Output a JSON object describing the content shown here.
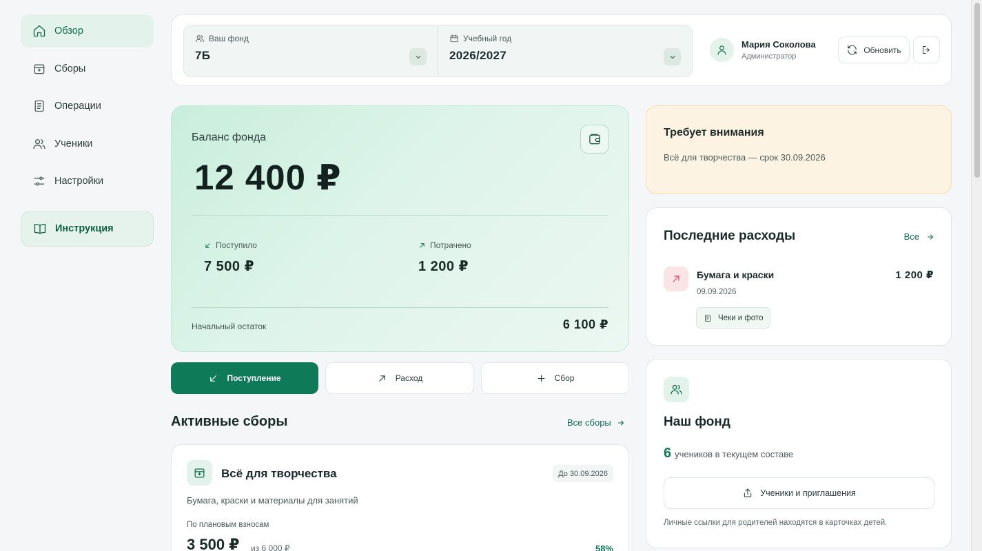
{
  "sidebar": {
    "items": [
      {
        "label": "Обзор",
        "icon": "home-icon",
        "active": true
      },
      {
        "label": "Сборы",
        "icon": "piggy-bank-icon"
      },
      {
        "label": "Операции",
        "icon": "document-icon"
      },
      {
        "label": "Ученики",
        "icon": "users-icon"
      },
      {
        "label": "Настройки",
        "icon": "sliders-icon"
      }
    ],
    "guide": {
      "label": "Инструкция",
      "icon": "book-icon"
    }
  },
  "topbar": {
    "fund_label": "Ваш фонд",
    "fund_value": "7Б",
    "year_label": "Учебный год",
    "year_value": "2026/2027",
    "user_name": "Мария Соколова",
    "user_role": "Администратор",
    "refresh_label": "Обновить"
  },
  "balance": {
    "title": "Баланс фонда",
    "amount": "12 400 ₽",
    "income_label": "Поступило",
    "income_value": "7 500 ₽",
    "spent_label": "Потрачено",
    "spent_value": "1 200 ₽",
    "start_label": "Начальный остаток",
    "start_value": "6 100 ₽"
  },
  "actions": {
    "income": "Поступление",
    "expense": "Расход",
    "collection": "Сбор"
  },
  "collections": {
    "title": "Активные сборы",
    "link": "Все сборы",
    "item": {
      "title": "Всё для творчества",
      "date": "До 30.09.2026",
      "description": "Бумага, краски и материалы для занятий",
      "plan_label": "По плановым взносам",
      "amount": "3 500 ₽",
      "of": "из 6 000 ₽",
      "percent": "58%"
    }
  },
  "attention": {
    "title": "Требует внимания",
    "text": "Всё для творчества — срок 30.09.2026"
  },
  "expenses": {
    "title": "Последние расходы",
    "link": "Все",
    "item": {
      "name": "Бумага и краски",
      "amount": "1 200 ₽",
      "date": "09.09.2026",
      "receipts": "Чеки и фото"
    }
  },
  "fund": {
    "title": "Наш фонд",
    "count": "6",
    "count_text": "учеников в текущем составе",
    "button": "Ученики и приглашения",
    "note": "Личные ссылки для родителей находятся в карточках детей."
  },
  "colors": {
    "accent": "#0f7a58",
    "active_bg": "#e3f2ea",
    "attention_bg": "#fdf3e2",
    "expense_icon": "#d9485a"
  }
}
